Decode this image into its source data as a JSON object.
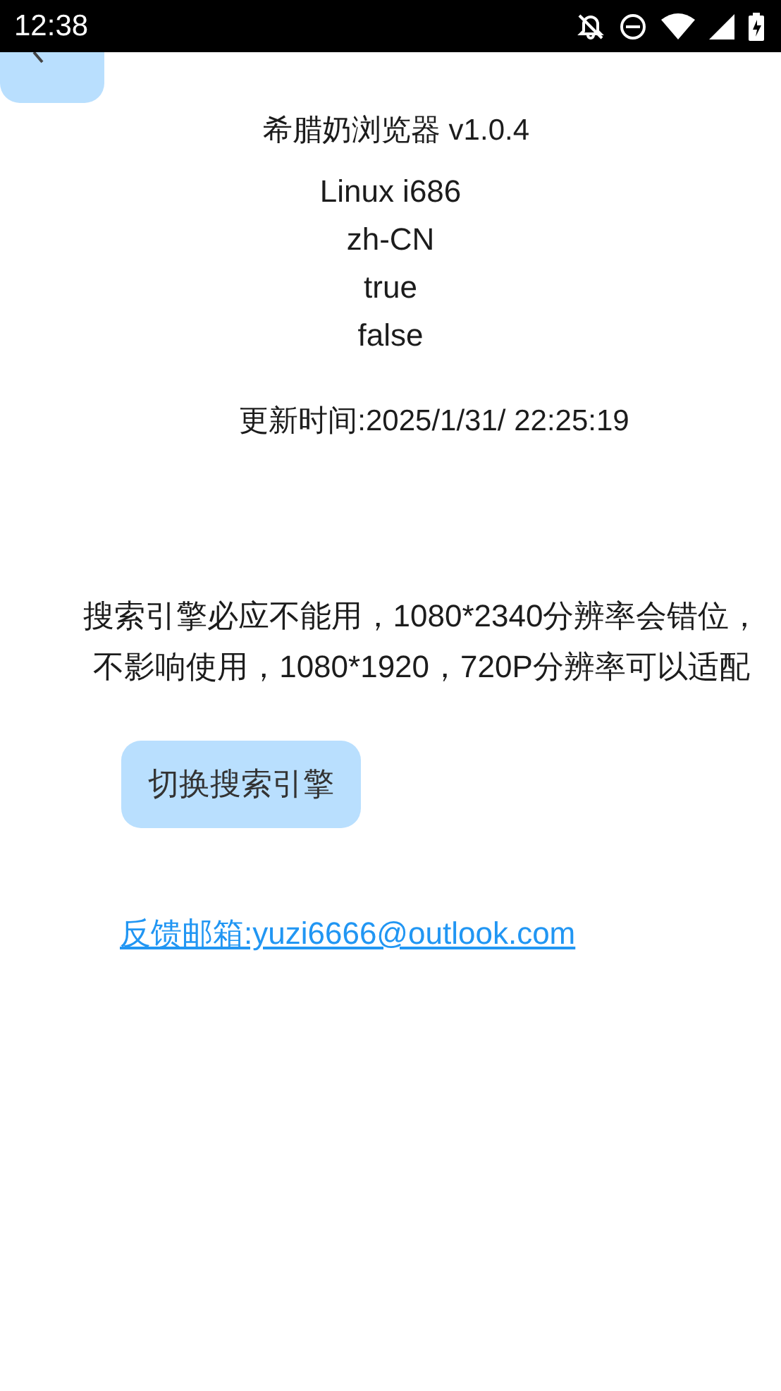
{
  "status_bar": {
    "time": "12:38"
  },
  "app_title": "希腊奶浏览器 v1.0.4",
  "info_lines": [
    "Linux i686",
    "zh-CN",
    "true",
    "false"
  ],
  "update_time": "更新时间:2025/1/31/ 22:25:19",
  "notice": "搜索引擎必应不能用，1080*2340分辨率会错位，不影响使用，1080*1920，720P分辨率可以适配",
  "switch_button": {
    "label": "切换搜索引擎"
  },
  "feedback_link": "反馈邮箱:yuzi6666@outlook.com"
}
